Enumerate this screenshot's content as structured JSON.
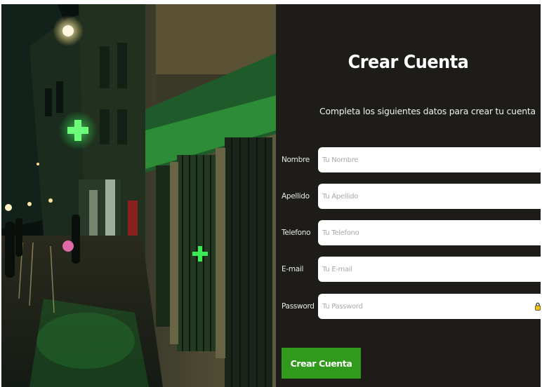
{
  "form": {
    "title": "Crear Cuenta",
    "subtitle": "Completa los siguientes datos para crear tu cuenta",
    "fields": [
      {
        "label": "Nombre",
        "placeholder": "Tu Nombre",
        "value": ""
      },
      {
        "label": "Apellido",
        "placeholder": "Tu Apellido",
        "value": ""
      },
      {
        "label": "Telefono",
        "placeholder": "Tu Telefono",
        "value": ""
      },
      {
        "label": "E-mail",
        "placeholder": "Tu E-mail",
        "value": ""
      },
      {
        "label": "Password",
        "placeholder": "Tu Password",
        "value": ""
      }
    ],
    "submit_label": "Crear Cuenta",
    "password_icon": "lock-icon"
  },
  "colors": {
    "panel_background": "#1d1c19",
    "button": "#2f9a1c",
    "pharmacy_cross": "#3dff5c"
  },
  "photo": {
    "subject": "night street with green pharmacy cross"
  }
}
